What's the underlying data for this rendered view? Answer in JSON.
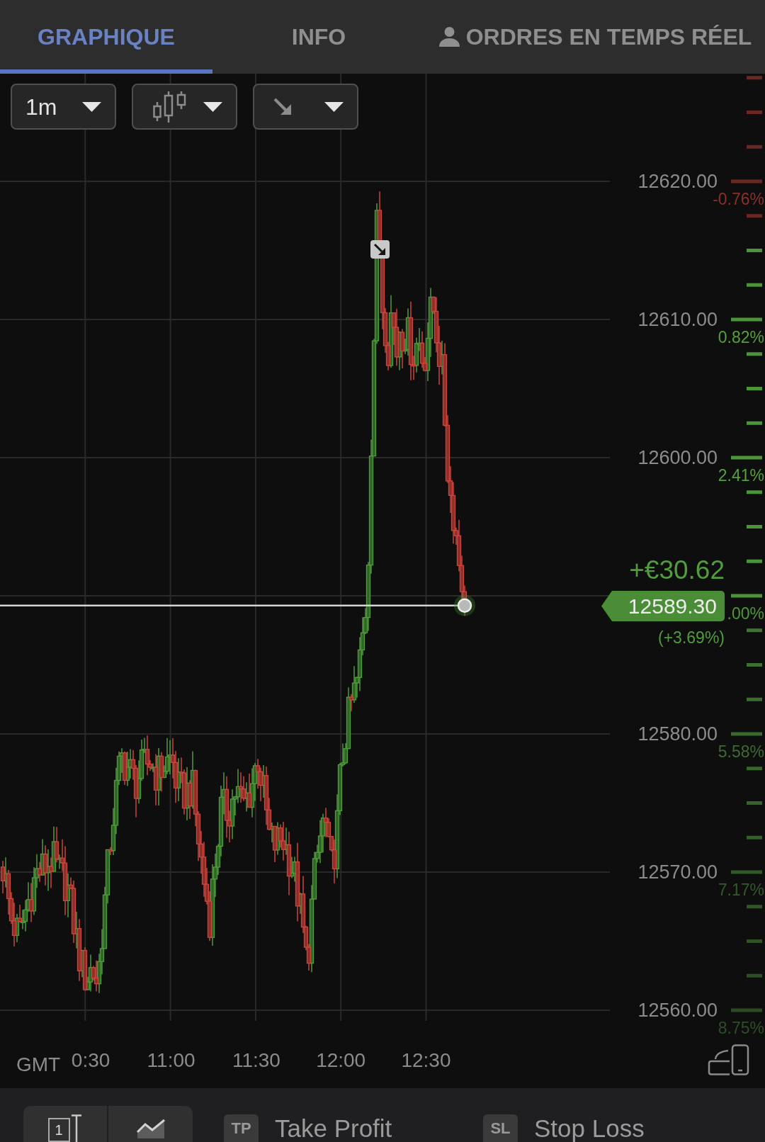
{
  "tabs": [
    {
      "label": "GRAPHIQUE",
      "selected": true,
      "kind": "plain"
    },
    {
      "label": "INFO",
      "selected": false,
      "kind": "plain"
    },
    {
      "label": "ORDRES EN TEMPS RÉEL",
      "selected": false,
      "kind": "user"
    }
  ],
  "chart_toolbar": [
    {
      "kind": "interval",
      "value": "1m"
    },
    {
      "kind": "chart-type"
    },
    {
      "kind": "drawing-tool"
    }
  ],
  "price_levels": [
    {
      "label": "12620.00",
      "change": "-0.76%",
      "color": "#8a302c"
    },
    {
      "label": "12610.00",
      "change": "0.82%",
      "color": "#55a03c"
    },
    {
      "label": "12600.00",
      "change": "2.41%",
      "color": "#55a03c"
    },
    {
      "change": ".00%",
      "color": "#4e9838"
    },
    {
      "label": "12580.00",
      "change": "5.58%",
      "color": "#3d6b2f"
    },
    {
      "label": "12570.00",
      "change": "7.17%",
      "color": "#34592b"
    },
    {
      "label": "12560.00",
      "change": "8.75%",
      "color": "#2e4e27"
    }
  ],
  "current_price": {
    "value": "12589.30",
    "profit": "+€30.62",
    "profit_percent": "(+3.69%)"
  },
  "time_axis": {
    "timezone": "GMT",
    "labels": [
      "0:30",
      "11:00",
      "11:30",
      "12:00",
      "12:30"
    ]
  },
  "bottom_bar": {
    "view_buttons": [
      {
        "kind": "count",
        "label": "1"
      },
      {
        "kind": "line-chart"
      }
    ],
    "order_buttons": [
      {
        "badge": "TP",
        "label": "Take Profit"
      },
      {
        "badge": "SL",
        "label": "Stop Loss"
      }
    ]
  }
}
